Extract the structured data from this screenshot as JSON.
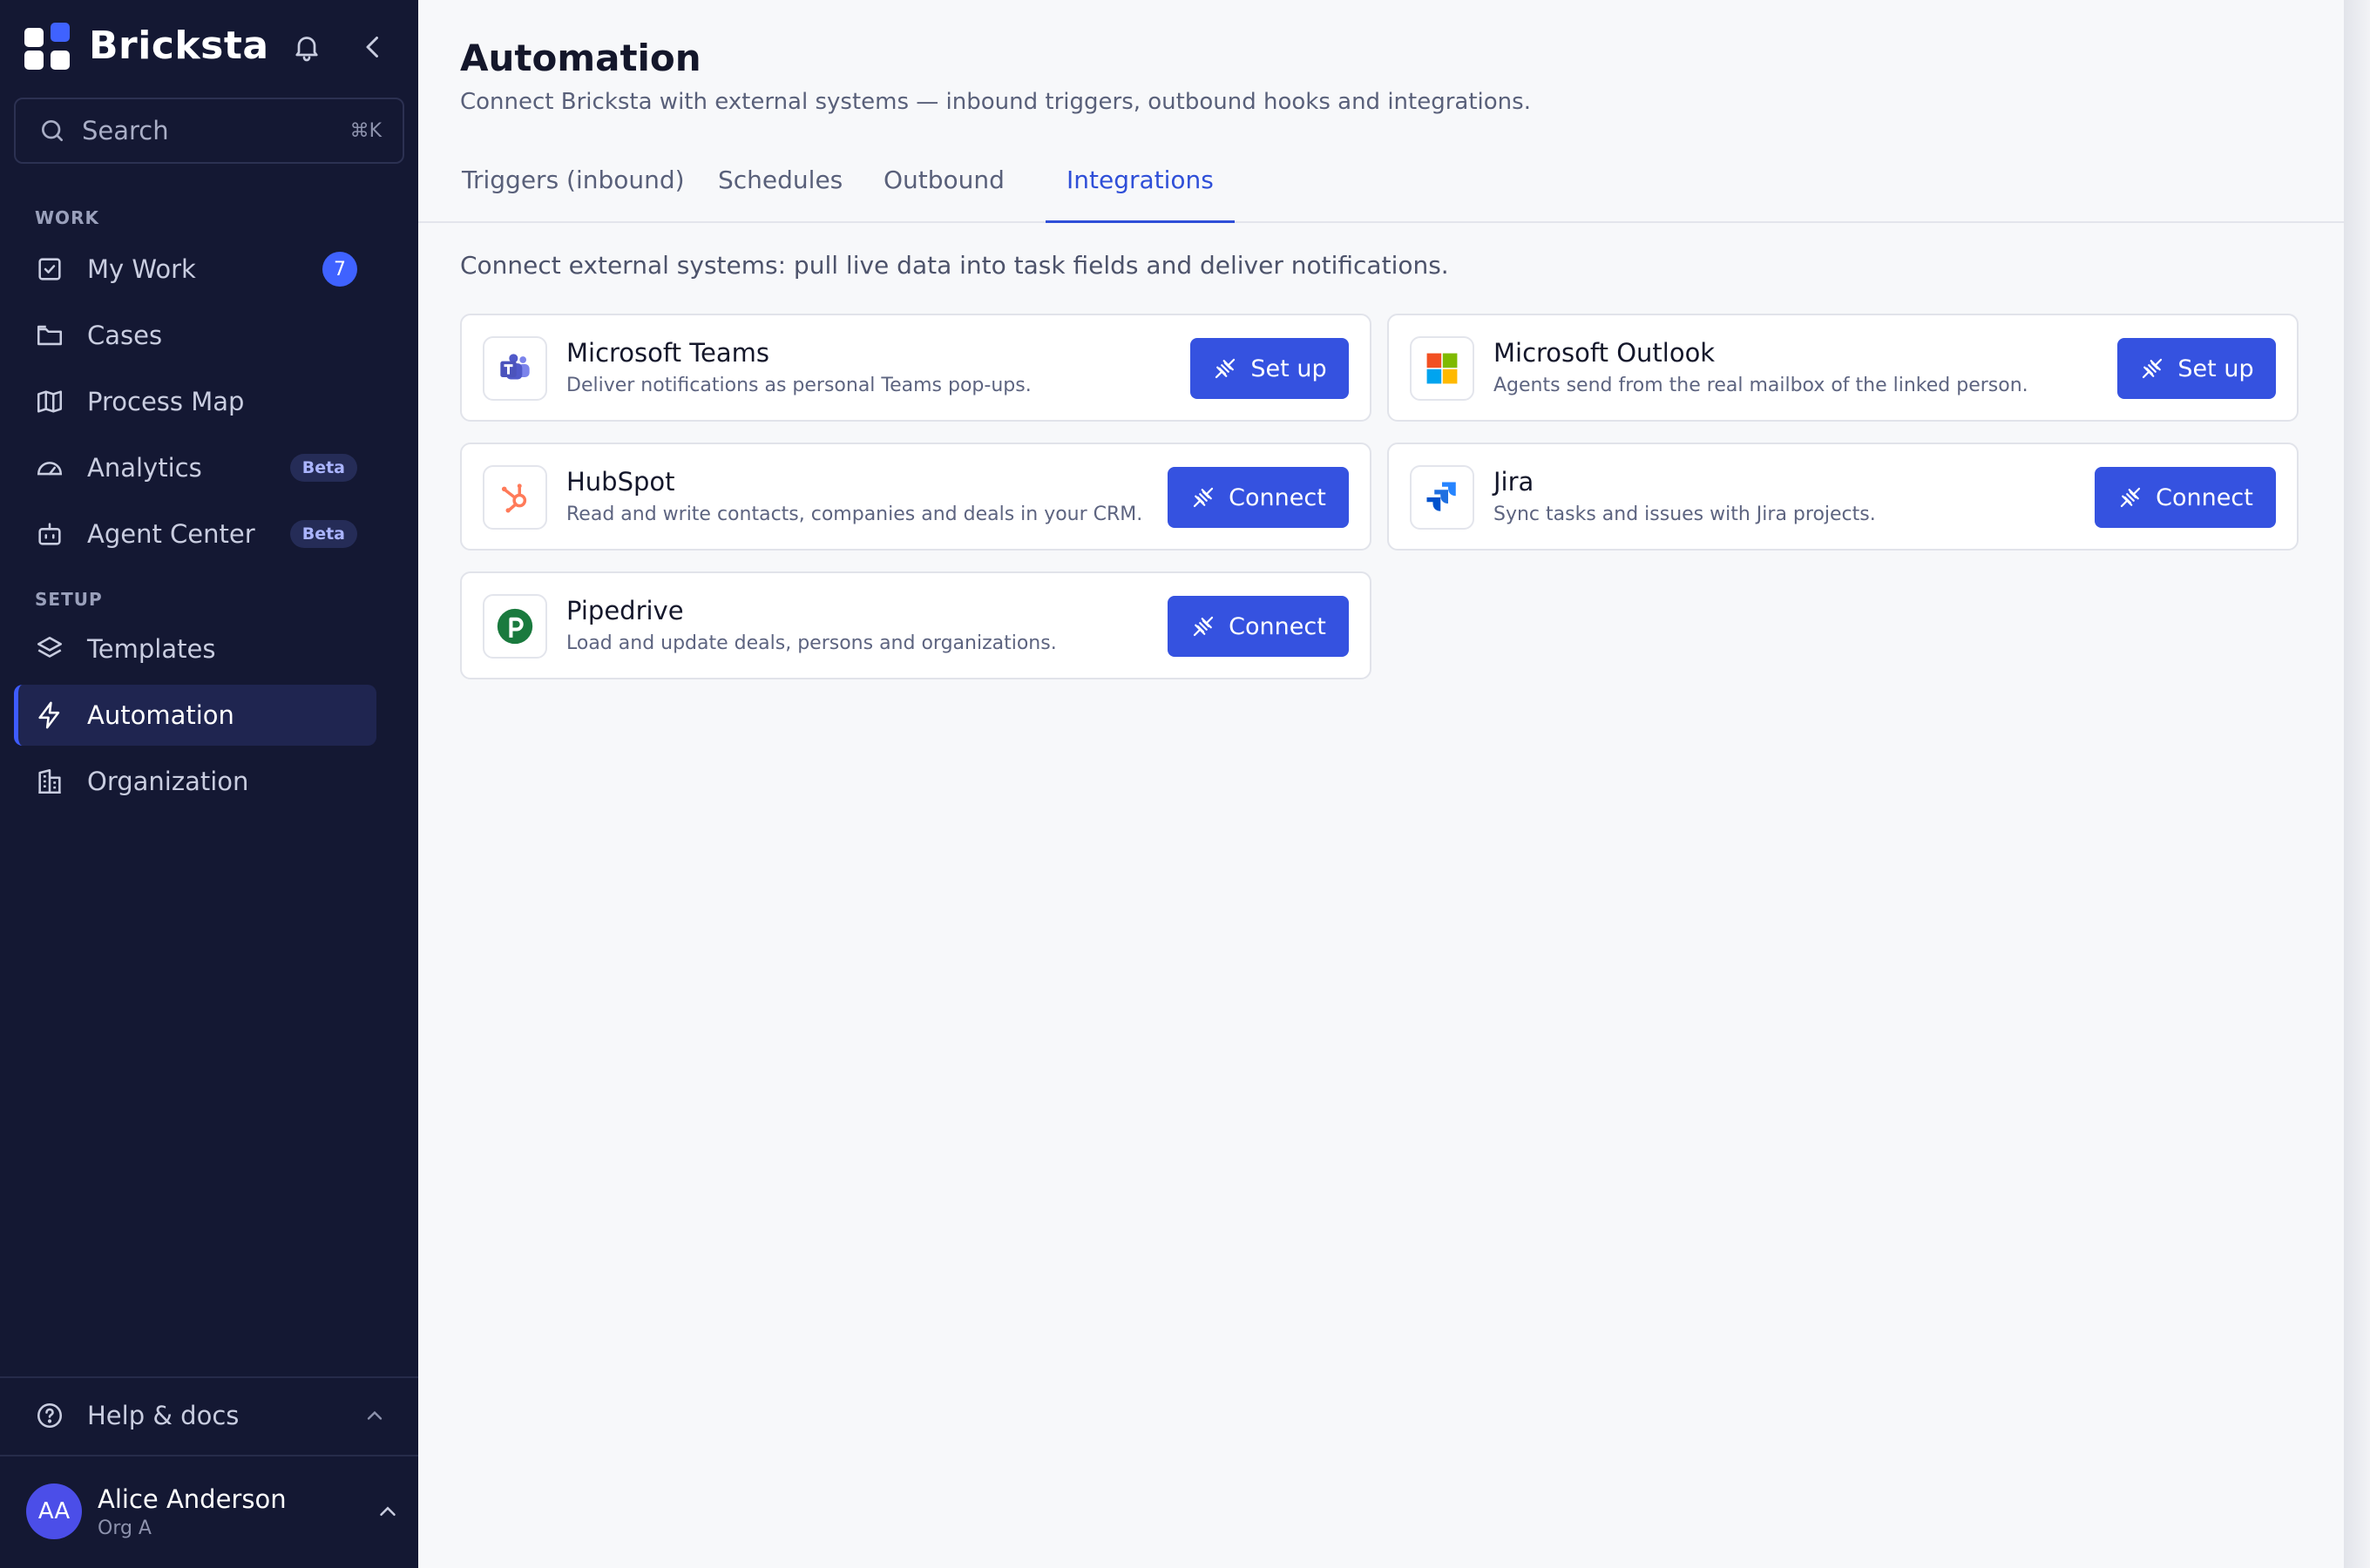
{
  "app": {
    "name": "Bricksta"
  },
  "search": {
    "placeholder": "Search",
    "shortcut": "⌘K"
  },
  "sidebar": {
    "sections": [
      {
        "label": "WORK"
      },
      {
        "label": "SETUP"
      }
    ],
    "items": [
      {
        "label": "My Work",
        "icon": "check-square-icon",
        "badge": "7"
      },
      {
        "label": "Cases",
        "icon": "folder-icon"
      },
      {
        "label": "Process Map",
        "icon": "map-icon"
      },
      {
        "label": "Analytics",
        "icon": "gauge-icon",
        "tag": "Beta"
      },
      {
        "label": "Agent Center",
        "icon": "bot-icon",
        "tag": "Beta"
      },
      {
        "label": "Templates",
        "icon": "layers-icon"
      },
      {
        "label": "Automation",
        "icon": "bolt-icon",
        "active": true
      },
      {
        "label": "Organization",
        "icon": "building-icon"
      }
    ],
    "help": {
      "label": "Help & docs"
    },
    "user": {
      "initials": "AA",
      "name": "Alice Anderson",
      "org": "Org A"
    }
  },
  "page": {
    "title": "Automation",
    "subtitle": "Connect Bricksta with external systems — inbound triggers, outbound hooks and integrations.",
    "tabs": [
      {
        "label": "Triggers (inbound)"
      },
      {
        "label": "Schedules"
      },
      {
        "label": "Outbound"
      },
      {
        "label": "Integrations",
        "active": true
      }
    ],
    "intro": "Connect external systems: pull live data into task fields and deliver notifications.",
    "integrations": [
      {
        "name": "Microsoft Teams",
        "description": "Deliver notifications as personal Teams pop-ups.",
        "action": "Set up",
        "icon": "teams-icon"
      },
      {
        "name": "Microsoft Outlook",
        "description": "Agents send from the real mailbox of the linked person.",
        "action": "Set up",
        "icon": "microsoft-icon"
      },
      {
        "name": "HubSpot",
        "description": "Read and write contacts, companies and deals in your CRM.",
        "action": "Connect",
        "icon": "hubspot-icon"
      },
      {
        "name": "Jira",
        "description": "Sync tasks and issues with Jira projects.",
        "action": "Connect",
        "icon": "jira-icon"
      },
      {
        "name": "Pipedrive",
        "description": "Load and update deals, persons and organizations.",
        "action": "Connect",
        "icon": "pipedrive-icon"
      }
    ]
  },
  "colors": {
    "sidebar_bg": "#141833",
    "accent": "#3552e0",
    "active_tab": "#2f4fd8"
  }
}
